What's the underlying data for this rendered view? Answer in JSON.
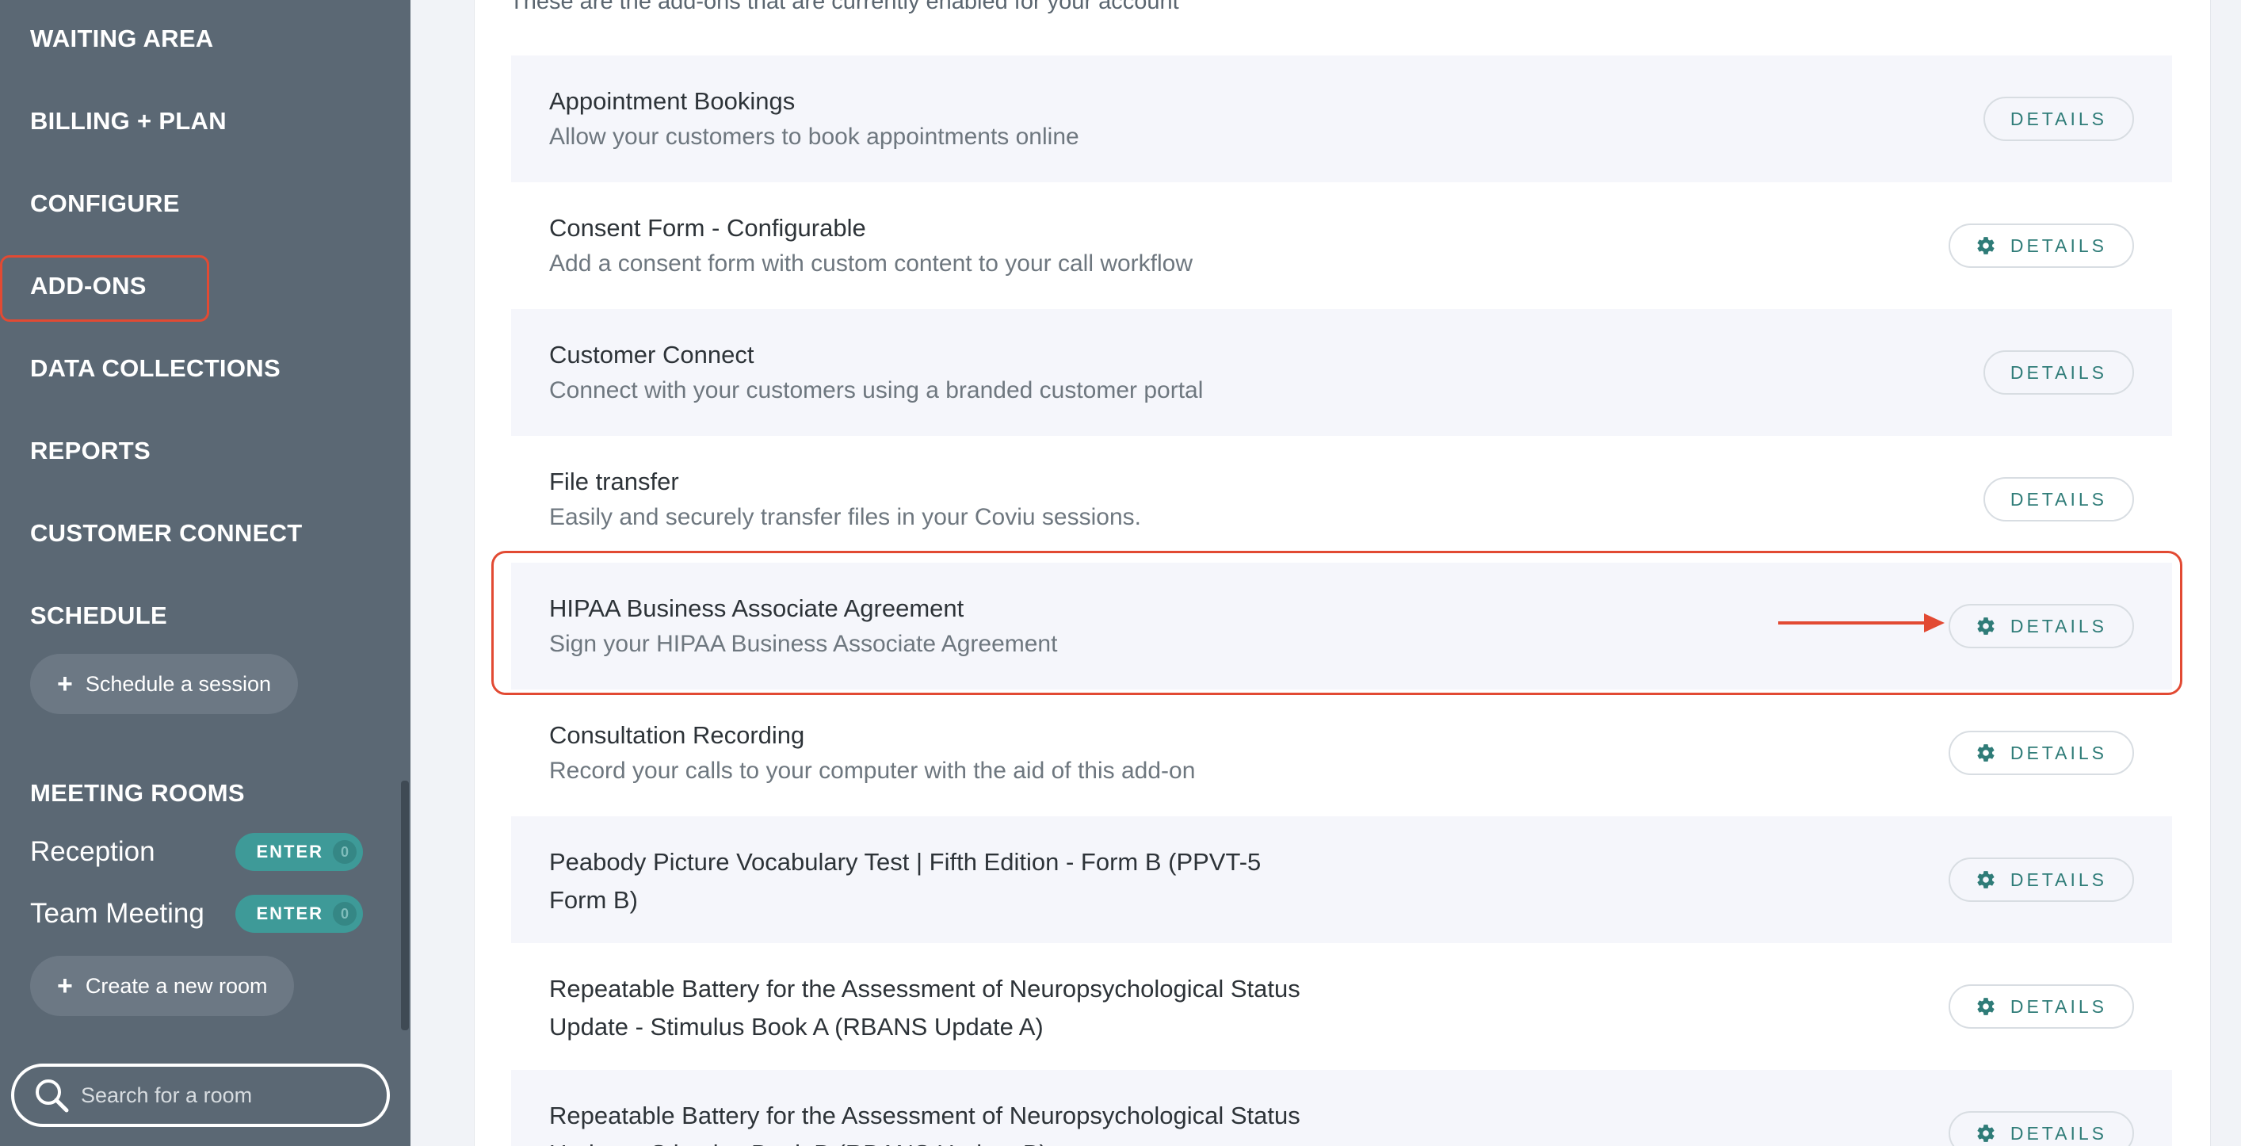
{
  "sidebar": {
    "nav": [
      "WAITING AREA",
      "BILLING + PLAN",
      "CONFIGURE",
      "ADD-ONS",
      "DATA COLLECTIONS",
      "REPORTS",
      "CUSTOMER CONNECT",
      "SCHEDULE"
    ],
    "schedule_button": "Schedule a session",
    "meeting_rooms_heading": "MEETING ROOMS",
    "rooms": [
      {
        "name": "Reception",
        "enter_label": "ENTER",
        "count": "0"
      },
      {
        "name": "Team Meeting",
        "enter_label": "ENTER",
        "count": "0"
      }
    ],
    "create_room_button": "Create a new room",
    "search_placeholder": "Search for a room"
  },
  "main": {
    "intro": "These are the add-ons that are currently enabled for your account",
    "details_label": "DETAILS",
    "addons": [
      {
        "title": "Appointment Bookings",
        "description": "Allow your customers to book appointments online",
        "gear_icon": false
      },
      {
        "title": "Consent Form - Configurable",
        "description": "Add a consent form with custom content to your call workflow",
        "gear_icon": true
      },
      {
        "title": "Customer Connect",
        "description": "Connect with your customers using a branded customer portal",
        "gear_icon": false
      },
      {
        "title": "File transfer",
        "description": "Easily and securely transfer files in your Coviu sessions.",
        "gear_icon": false
      },
      {
        "title": "HIPAA Business Associate Agreement",
        "description": "Sign your HIPAA Business Associate Agreement",
        "gear_icon": true
      },
      {
        "title": "Consultation Recording",
        "description": "Record your calls to your computer with the aid of this add-on",
        "gear_icon": true
      },
      {
        "title": "Peabody Picture Vocabulary Test | Fifth Edition - Form B (PPVT-5 Form B)",
        "description": "",
        "gear_icon": true
      },
      {
        "title": "Repeatable Battery for the Assessment of Neuropsychological Status Update - Stimulus Book A (RBANS Update A)",
        "description": "",
        "gear_icon": true
      },
      {
        "title": "Repeatable Battery for the Assessment of Neuropsychological Status Update - Stimulus Book B (RBANS Update B)",
        "description": "",
        "gear_icon": true
      }
    ]
  },
  "colors": {
    "sidebar_bg": "#5b6874",
    "accent_teal": "#2f7c78",
    "enter_badge": "#3e9a98",
    "annotation_red": "#e24a33",
    "row_shade": "#f5f6fb"
  }
}
